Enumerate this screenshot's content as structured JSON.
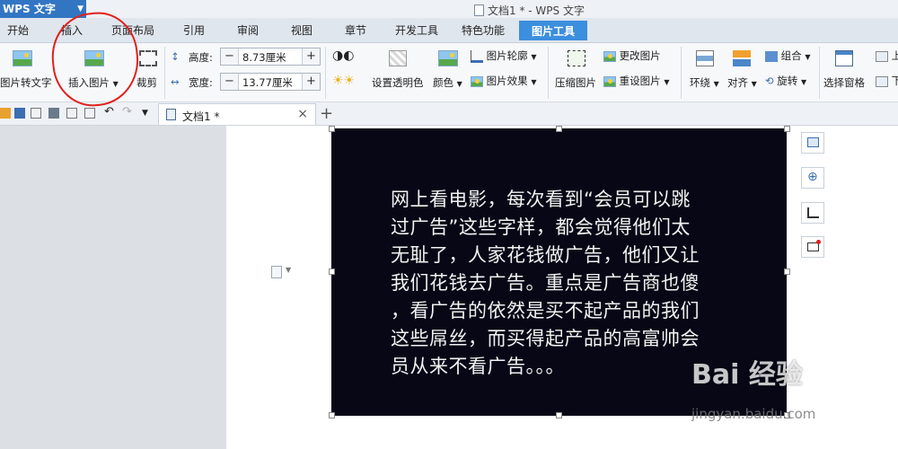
{
  "title_bar": {
    "app_menu_label": "WPS 文字",
    "window_title": "文档1 * - WPS 文字"
  },
  "tabs": [
    {
      "label": "开始"
    },
    {
      "label": "插入"
    },
    {
      "label": "页面布局"
    },
    {
      "label": "引用"
    },
    {
      "label": "审阅"
    },
    {
      "label": "视图"
    },
    {
      "label": "章节"
    },
    {
      "label": "开发工具"
    },
    {
      "label": "特色功能"
    },
    {
      "label": "图片工具",
      "active": true
    }
  ],
  "ribbon": {
    "pic_to_text": "图片转文字",
    "insert_picture": "插入图片",
    "crop": "裁剪",
    "height_label": "高度:",
    "height_value": "8.73厘米",
    "width_label": "宽度:",
    "width_value": "13.77厘米",
    "set_transparent": "设置透明色",
    "color": "颜色",
    "picture_outline": "图片轮廓",
    "picture_effect": "图片效果",
    "compress": "压缩图片",
    "change_picture": "更改图片",
    "reset_picture": "重设图片",
    "wrap": "环绕",
    "align": "对齐",
    "group": "组合",
    "rotate": "旋转",
    "selection_pane": "选择窗格",
    "bring_forward_partial": "上",
    "send_backward_partial": "下"
  },
  "document_tab": {
    "name": "文档1 *"
  },
  "picture_text": [
    "网上看电影，每次看到“会员可以跳",
    "过广告”这些字样，都会觉得他们太",
    "无耻了，人家花钱做广告，他们又让",
    "我们花钱去广告。重点是广告商也傻",
    "，看广告的依然是买不起产品的我们",
    "这些屌丝，而买得起产品的高富帅会",
    "员从来不看广告。。。"
  ],
  "watermark": {
    "logo": "Bai 经验",
    "url": "jingyan.baidu.com"
  },
  "colors": {
    "accent": "#3c8ede",
    "app_button": "#3276c3",
    "annotation": "#e0201c",
    "picture_bg": "#070716"
  }
}
